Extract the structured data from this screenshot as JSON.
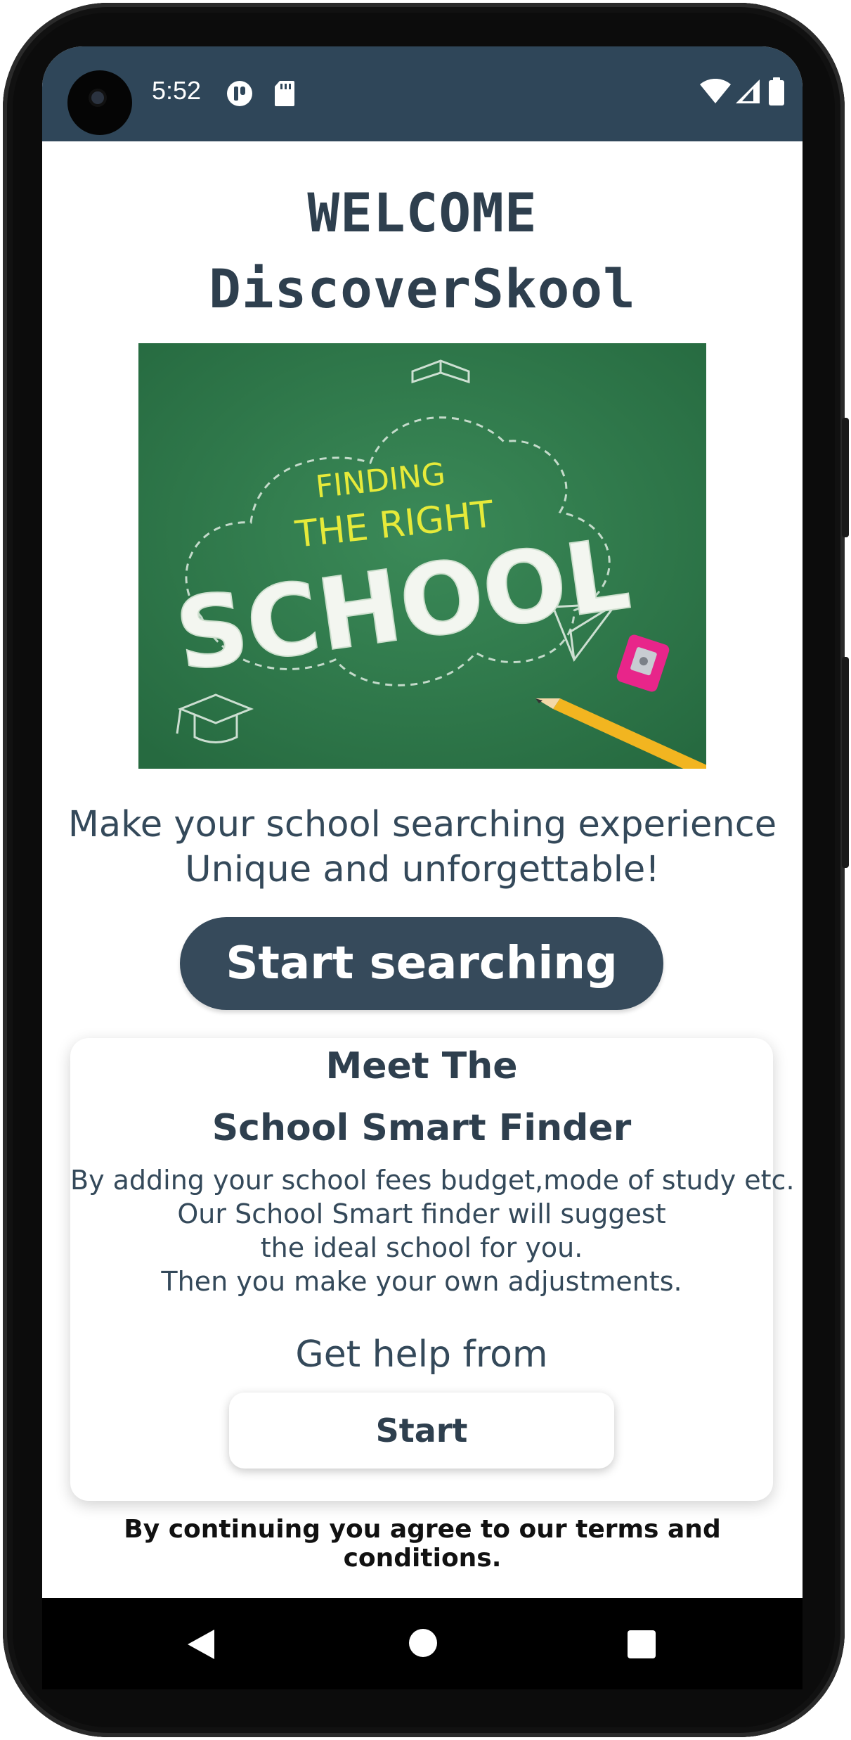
{
  "status_bar": {
    "time": "5:52",
    "background_color": "#2f4659",
    "left_icons": [
      "notification-app-icon",
      "sd-card-icon"
    ],
    "right_icons": [
      "wifi-icon",
      "cell-signal-icon",
      "battery-icon"
    ]
  },
  "header": {
    "welcome": "WELCOME",
    "app_name": "DiscoverSkool"
  },
  "hero_image": {
    "line1": "FINDING",
    "line2": "THE RIGHT",
    "line3": "SCHOOL",
    "background_color": "#2f7a4d"
  },
  "tagline": {
    "line1": "Make your school searching experience",
    "line2": "Unique and unforgettable!"
  },
  "primary_button": {
    "label": "Start searching",
    "color": "#364a5b"
  },
  "finder_card": {
    "heading1": "Meet The",
    "heading2": "School Smart Finder",
    "description": [
      "By adding your school fees budget,mode of study etc.",
      "Our School Smart finder will suggest",
      "the ideal school for you.",
      "Then you make your own adjustments."
    ],
    "help_text": "Get help from",
    "start_label": "Start"
  },
  "terms_text": "By continuing you agree to our terms and conditions.",
  "nav_bar": {
    "icons": [
      "back-icon",
      "home-icon",
      "recents-icon"
    ]
  }
}
